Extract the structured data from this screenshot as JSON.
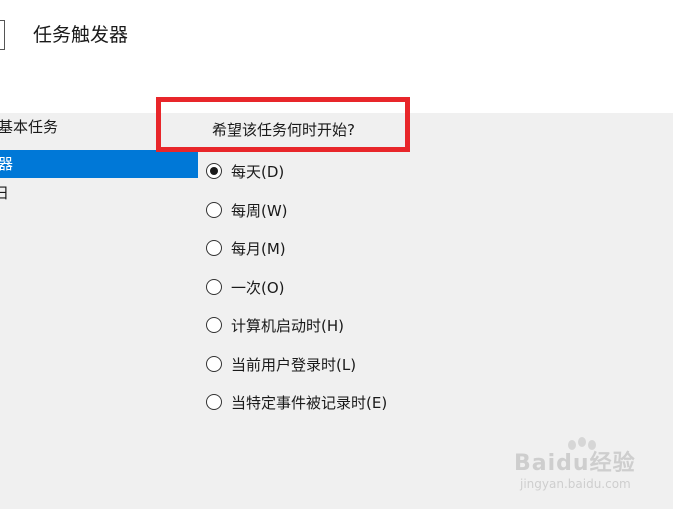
{
  "header": {
    "title": "任务触发器"
  },
  "nav": {
    "items": [
      {
        "label": "基本任务"
      },
      {
        "label": "器"
      },
      {
        "label": "日"
      }
    ]
  },
  "main": {
    "question": "希望该任务何时开始?",
    "options": [
      {
        "label": "每天(D)",
        "selected": true
      },
      {
        "label": "每周(W)",
        "selected": false
      },
      {
        "label": "每月(M)",
        "selected": false
      },
      {
        "label": "一次(O)",
        "selected": false
      },
      {
        "label": "计算机启动时(H)",
        "selected": false
      },
      {
        "label": "当前用户登录时(L)",
        "selected": false
      },
      {
        "label": "当特定事件被记录时(E)",
        "selected": false
      }
    ]
  },
  "watermark": {
    "brand": "Baidu经验",
    "url": "jingyan.baidu.com"
  },
  "colors": {
    "selection": "#0078d7",
    "highlight_box": "#e8262a"
  }
}
